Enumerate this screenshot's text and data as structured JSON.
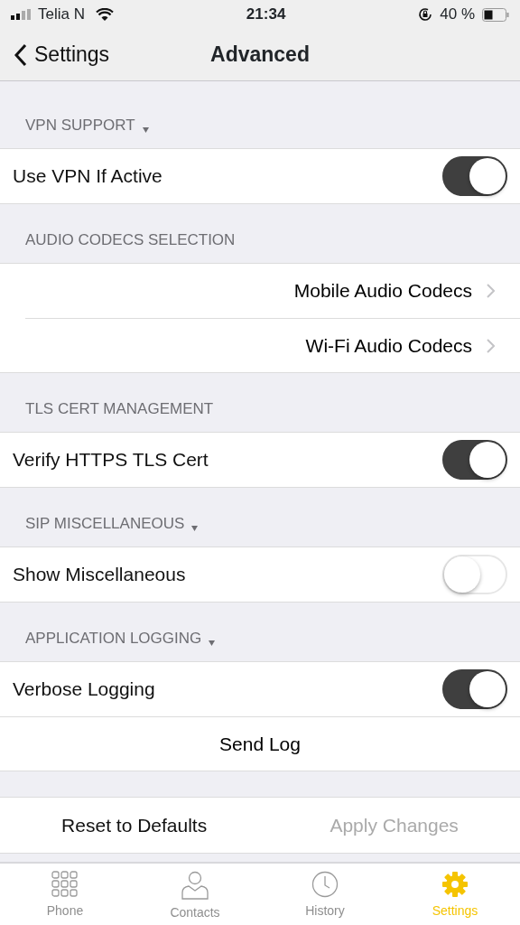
{
  "status_bar": {
    "carrier": "Telia N",
    "time": "21:34",
    "battery": "40 %"
  },
  "nav": {
    "back": "Settings",
    "title": "Advanced"
  },
  "sections": [
    {
      "header": "VPN SUPPORT",
      "collapsible": true,
      "rows": [
        {
          "kind": "toggle",
          "label": "Use VPN If Active",
          "on": true
        }
      ]
    },
    {
      "header": "AUDIO CODECS SELECTION",
      "collapsible": false,
      "rows": [
        {
          "kind": "link",
          "label": "Mobile Audio Codecs"
        },
        {
          "kind": "link",
          "label": "Wi-Fi Audio Codecs"
        }
      ]
    },
    {
      "header": "TLS CERT MANAGEMENT",
      "collapsible": false,
      "rows": [
        {
          "kind": "toggle",
          "label": "Verify HTTPS TLS Cert",
          "on": true
        }
      ]
    },
    {
      "header": "SIP MISCELLANEOUS",
      "collapsible": true,
      "rows": [
        {
          "kind": "toggle",
          "label": "Show Miscellaneous",
          "on": false
        }
      ]
    },
    {
      "header": "APPLICATION LOGGING",
      "collapsible": true,
      "rows": [
        {
          "kind": "toggle",
          "label": "Verbose Logging",
          "on": true
        },
        {
          "kind": "action",
          "label": "Send Log"
        }
      ]
    }
  ],
  "footer_buttons": [
    {
      "label": "Reset to Defaults",
      "disabled": false
    },
    {
      "label": "Apply Changes",
      "disabled": true
    }
  ],
  "tabs": [
    {
      "label": "Phone",
      "selected": false
    },
    {
      "label": "Contacts",
      "selected": false
    },
    {
      "label": "History",
      "selected": false
    },
    {
      "label": "Settings",
      "selected": true
    }
  ]
}
